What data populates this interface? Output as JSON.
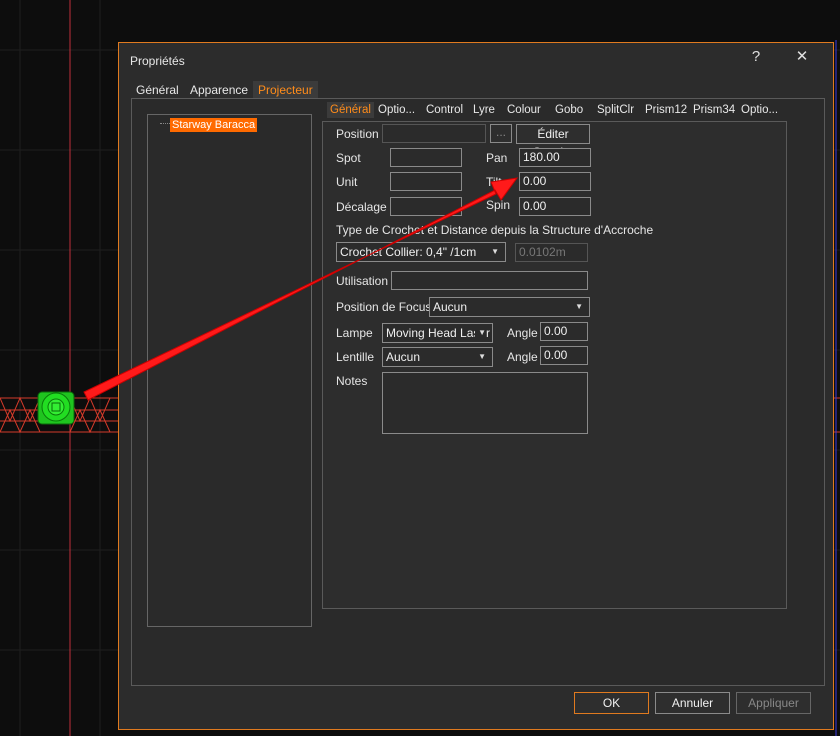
{
  "dialog": {
    "title": "Propriétés",
    "help_glyph": "?",
    "close_glyph": "✕",
    "tabs": [
      "Général",
      "Apparence",
      "Projecteur"
    ],
    "active_tab": "Projecteur"
  },
  "tree": {
    "items": [
      "Starway Baracca"
    ]
  },
  "inner_tabs": [
    "Général",
    "Optio...",
    "Control",
    "Lyre",
    "Colour",
    "Gobo",
    "SplitClr",
    "Prism12",
    "Prism34",
    "Optio..."
  ],
  "form": {
    "position_label": "Position",
    "position_value": "",
    "browse_label": "...",
    "edit_layer_button": "Éditer Couche",
    "spot_label": "Spot",
    "spot_value": "",
    "pan_label": "Pan",
    "pan_value": "180.00",
    "unit_label": "Unit",
    "unit_value": "",
    "tilt_label": "Tilt",
    "tilt_value": "0.00",
    "offset_label": "Décalage",
    "offset_value": "",
    "spin_label": "Spin",
    "spin_value": "0.00",
    "hook_type_label": "Type de Crochet et  Distance depuis la Structure d'Accroche",
    "hook_type_value": "Crochet Collier: 0,4\" /1cm",
    "hook_distance_value": "0.0102m",
    "usage_label": "Utilisation",
    "usage_value": "",
    "focus_label": "Position de Focus",
    "focus_value": "Aucun",
    "lamp_label": "Lampe",
    "lamp_value": "Moving Head Laser",
    "lamp_angle_label": "Angle",
    "lamp_angle_value": "0.00",
    "lens_label": "Lentille",
    "lens_value": "Aucun",
    "lens_angle_label": "Angle",
    "lens_angle_value": "0.00",
    "notes_label": "Notes",
    "notes_value": ""
  },
  "buttons": {
    "ok": "OK",
    "cancel": "Annuler",
    "apply": "Appliquer"
  },
  "colors": {
    "accent": "#ff6a00",
    "border_accent": "#e07a1f",
    "arrow": "#ff1a1a",
    "fixture": "#22dd22"
  }
}
